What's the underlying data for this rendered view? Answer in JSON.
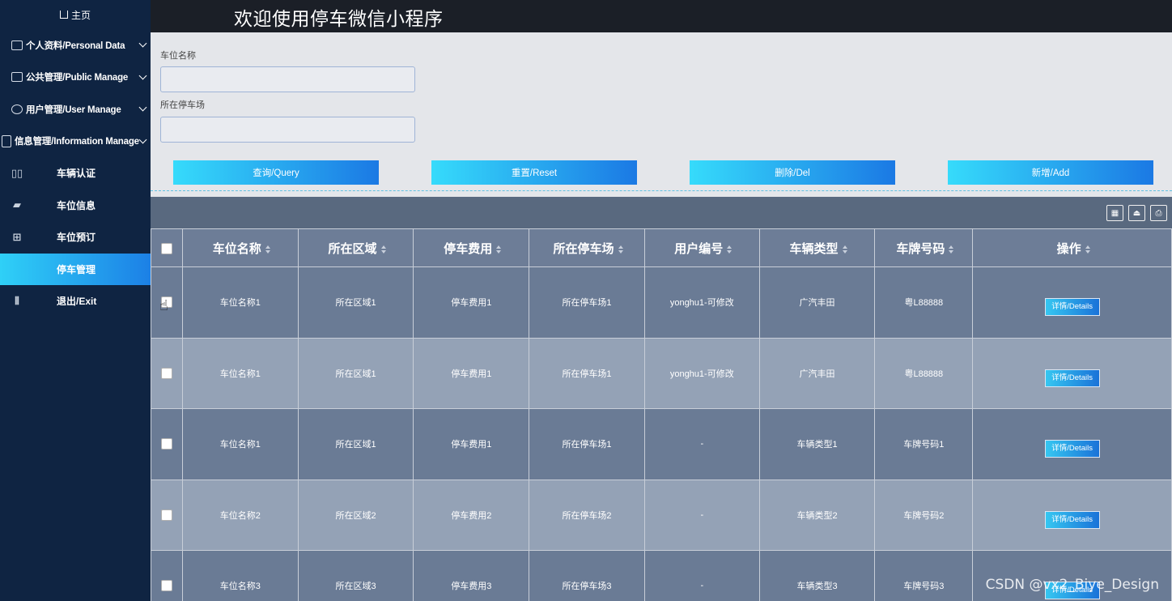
{
  "app": {
    "title": "欢迎使用停车微信小程序"
  },
  "sidebar": {
    "home_label": "主页",
    "groups": [
      {
        "label": "个人资料/Personal Data",
        "icon": "id-card-icon"
      },
      {
        "label": "公共管理/Public Manage",
        "icon": "monitor-icon"
      },
      {
        "label": "用户管理/User Manage",
        "icon": "user-edit-icon"
      },
      {
        "label": "信息管理/Information Manage",
        "icon": "document-icon"
      }
    ],
    "items": [
      {
        "label": "车辆认证",
        "icon": "book-icon",
        "active": false
      },
      {
        "label": "车位信息",
        "icon": "ruler-icon",
        "active": false
      },
      {
        "label": "车位预订",
        "icon": "grid-search-icon",
        "active": false
      },
      {
        "label": "停车管理",
        "icon": "",
        "active": true
      },
      {
        "label": "退出/Exit",
        "icon": "library-icon",
        "active": false
      }
    ]
  },
  "search": {
    "field1_label": "车位名称",
    "field1_value": "",
    "field2_label": "所在停车场",
    "field2_value": "",
    "buttons": {
      "query": "查询/Query",
      "reset": "重置/Reset",
      "delete": "删除/Del",
      "add": "新增/Add"
    }
  },
  "table": {
    "headers": [
      "车位名称",
      "所在区域",
      "停车费用",
      "所在停车场",
      "用户编号",
      "车辆类型",
      "车牌号码",
      "操作"
    ],
    "detail_label": "详情/Details",
    "rows": [
      [
        "车位名称1",
        "所在区域1",
        "停车费用1",
        "所在停车场1",
        "yonghu1-可修改",
        "广汽丰田",
        "粤L88888"
      ],
      [
        "车位名称1",
        "所在区域1",
        "停车费用1",
        "所在停车场1",
        "yonghu1-可修改",
        "广汽丰田",
        "粤L88888"
      ],
      [
        "车位名称1",
        "所在区域1",
        "停车费用1",
        "所在停车场1",
        "-",
        "车辆类型1",
        "车牌号码1"
      ],
      [
        "车位名称2",
        "所在区域2",
        "停车费用2",
        "所在停车场2",
        "-",
        "车辆类型2",
        "车牌号码2"
      ],
      [
        "车位名称3",
        "所在区域3",
        "停车费用3",
        "所在停车场3",
        "-",
        "车辆类型3",
        "车牌号码3"
      ]
    ]
  },
  "watermark": "CSDN @vx2_Biye_Design"
}
